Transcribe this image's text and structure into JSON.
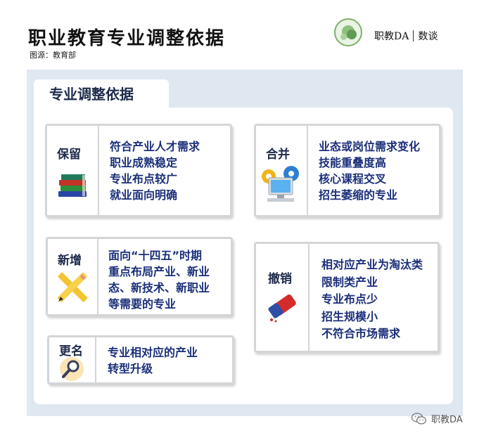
{
  "header": {
    "title": "职业教育专业调整依据",
    "source": "图源：教育部",
    "brand_left": "职教DA",
    "brand_right": "数谈"
  },
  "panel": {
    "title": "专业调整依据"
  },
  "cards": {
    "retain": {
      "label": "保留",
      "icon": "books-icon",
      "lines": [
        "符合产业人才需求",
        "职业成熟稳定",
        "专业布点较广",
        "就业面向明确"
      ]
    },
    "merge": {
      "label": "合并",
      "icon": "computer-gears-icon",
      "lines": [
        "业态或岗位需求变化",
        "技能重叠度高",
        "核心课程交叉",
        "招生萎缩的专业"
      ]
    },
    "add": {
      "label": "新增",
      "icon": "pencil-ruler-icon",
      "lines": [
        "面向“十四五”时期",
        "重点布局产业、新业",
        "态、新技术、新职业",
        "等需要的专业"
      ]
    },
    "cancel": {
      "label": "撤销",
      "icon": "eraser-icon",
      "lines": [
        "相对应产业为淘汰类",
        "限制类产业",
        "专业布点少",
        "招生规模小",
        "不符合市场需求"
      ]
    },
    "rename": {
      "label": "更名",
      "icon": "magnifier-icon",
      "lines": [
        "专业相对应的产业",
        "转型升级"
      ]
    }
  },
  "watermark": {
    "text": "职教DA",
    "icon": "wechat-icon"
  },
  "colors": {
    "panel_bg": "#dfe7f1",
    "card_border": "#d3d5d8",
    "text_blue": "#1b2f7a",
    "label_dark": "#1d2a4a"
  }
}
